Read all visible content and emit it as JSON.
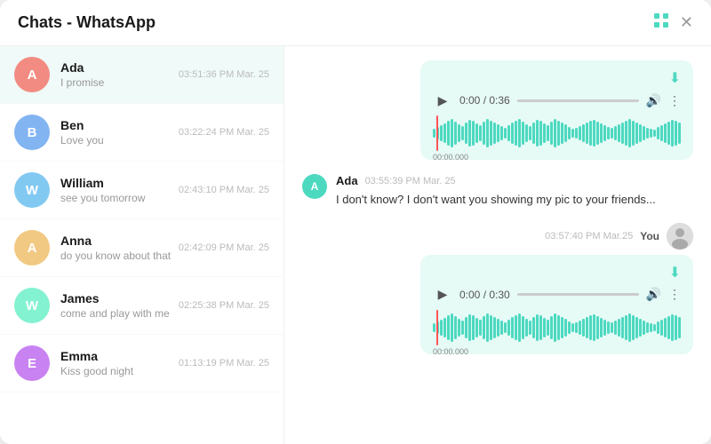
{
  "titlebar": {
    "title": "Chats - WhatsApp"
  },
  "sidebar": {
    "chats": [
      {
        "id": "ada",
        "name": "Ada",
        "preview": "I promise",
        "time": "03:51:36 PM Mar. 25",
        "avatar_letter": "A",
        "avatar_color": "#f28b82",
        "active": true
      },
      {
        "id": "ben",
        "name": "Ben",
        "preview": "Love you",
        "time": "03:22:24 PM Mar. 25",
        "avatar_letter": "B",
        "avatar_color": "#82b4f2",
        "active": false
      },
      {
        "id": "william",
        "name": "William",
        "preview": "see you tomorrow",
        "time": "02:43:10 PM Mar. 25",
        "avatar_letter": "W",
        "avatar_color": "#82c9f2",
        "active": false
      },
      {
        "id": "anna",
        "name": "Anna",
        "preview": "do you know about that",
        "time": "02:42:09 PM Mar. 25",
        "avatar_letter": "A",
        "avatar_color": "#f2c982",
        "active": false
      },
      {
        "id": "james",
        "name": "James",
        "preview": "come and play with me",
        "time": "02:25:38 PM Mar. 25",
        "avatar_letter": "W",
        "avatar_color": "#82f2d0",
        "active": false
      },
      {
        "id": "emma",
        "name": "Emma",
        "preview": "Kiss good night",
        "time": "01:13:19 PM Mar. 25",
        "avatar_letter": "E",
        "avatar_color": "#c982f2",
        "active": false
      }
    ]
  },
  "chat": {
    "messages": [
      {
        "type": "audio_incoming",
        "time": "0:00 / 0:36",
        "duration": "0:36"
      },
      {
        "type": "text_incoming",
        "sender": "Ada",
        "sender_letter": "A",
        "timestamp": "03:55:39 PM Mar. 25",
        "text": "I don't know? I don't want you showing my pic to your friends..."
      },
      {
        "type": "audio_outgoing",
        "timestamp": "03:57:40 PM Mar.25",
        "label": "You",
        "time": "0:00 / 0:30",
        "duration": "0:30"
      }
    ]
  }
}
